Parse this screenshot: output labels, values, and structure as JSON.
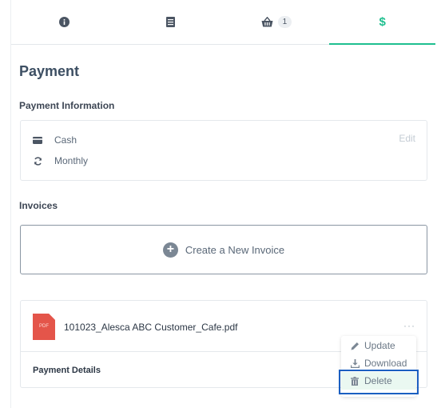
{
  "tabs": [
    {
      "icon": "info-icon"
    },
    {
      "icon": "document-icon"
    },
    {
      "icon": "basket-icon",
      "badge": "1"
    },
    {
      "icon": "dollar-icon",
      "label": "$",
      "active": true
    }
  ],
  "page": {
    "title": "Payment"
  },
  "payment_info": {
    "heading": "Payment Information",
    "method": {
      "icon": "card-icon",
      "label": "Cash"
    },
    "frequency": {
      "icon": "refresh-icon",
      "label": "Monthly"
    },
    "edit_label": "Edit"
  },
  "invoices": {
    "heading": "Invoices",
    "create_label": "Create a New Invoice",
    "file": {
      "icon": "pdf-file-icon",
      "icon_text": "PDF",
      "name": "101023_Alesca ABC Customer_Cafe.pdf"
    },
    "more_label": "···",
    "details_label": "Payment Details"
  },
  "context_menu": {
    "items": [
      {
        "icon": "pencil-icon",
        "label": "Update"
      },
      {
        "icon": "download-icon",
        "label": "Download"
      },
      {
        "icon": "trash-icon",
        "label": "Delete",
        "highlighted": true
      }
    ]
  },
  "colors": {
    "accent": "#1fbf8f",
    "focus": "#1b5fc1",
    "pdf": "#e4554a"
  }
}
